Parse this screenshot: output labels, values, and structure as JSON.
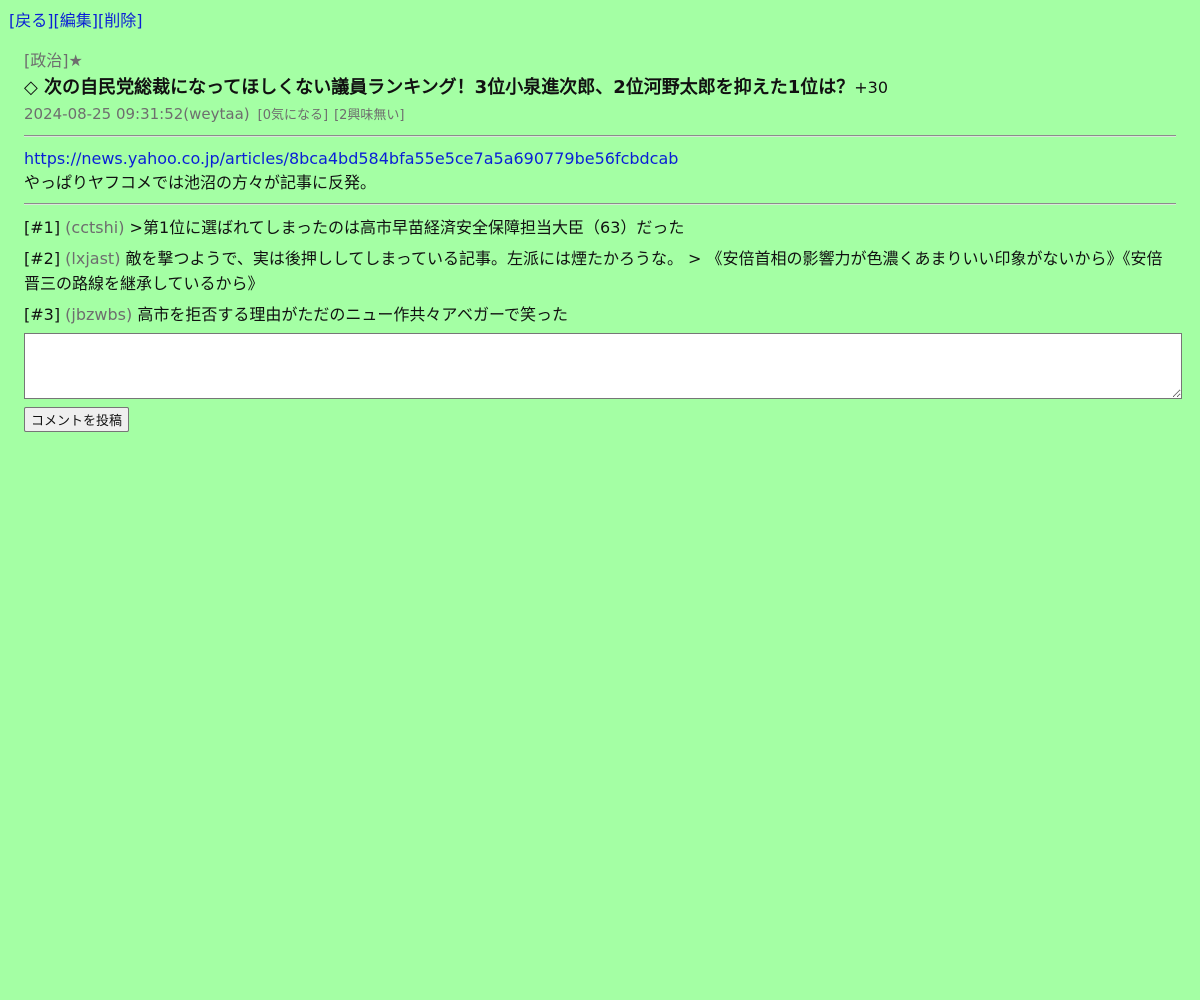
{
  "nav": {
    "back": "[戻る]",
    "edit": "[編集]",
    "delete": "[削除]"
  },
  "post": {
    "category": "[政治]★",
    "title": "◇ 次の自民党総裁になってほしくない議員ランキング！3位小泉進次郎、2位河野太郎を抑えた1位は？",
    "score": "+30",
    "datetime_user": "2024-08-25 09:31:52(weytaa)",
    "vote_interested": "[0気になる]",
    "vote_not_interested": "[2興味無い]",
    "url": "https://news.yahoo.co.jp/articles/8bca4bd584bfa55e5ce7a5a690779be56fcbdcab",
    "description": "やっぱりヤフコメでは池沼の方々が記事に反発。"
  },
  "comments": [
    {
      "num": "[#1]",
      "user": "(cctshi)",
      "text": ">第1位に選ばれてしまったのは高市早苗経済安全保障担当大臣（63）だった"
    },
    {
      "num": "[#2]",
      "user": "(lxjast)",
      "text": "敵を撃つようで、実は後押ししてしまっている記事。左派には煙たかろうな。 > 《安倍首相の影響力が色濃くあまりいい印象がないから》《安倍晋三の路線を継承しているから》"
    },
    {
      "num": "[#3]",
      "user": "(jbzwbs)",
      "text": "高市を拒否する理由がただのニュー作共々アベガーで笑った"
    }
  ],
  "form": {
    "comment_value": "",
    "submit_label": "コメントを投稿"
  },
  "colors": {
    "background": "#a4ffa4",
    "link": "#0a1fd6",
    "muted": "#6e6e6e"
  }
}
